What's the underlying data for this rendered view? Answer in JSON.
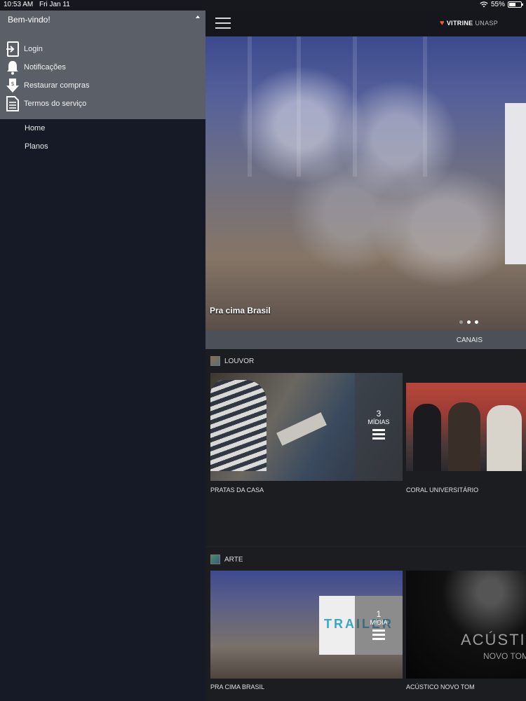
{
  "status_bar": {
    "time": "10:53 AM",
    "date": "Fri Jan 11",
    "battery": "55%",
    "battery_level": 0.55
  },
  "drawer": {
    "welcome": "Bem-vindo!",
    "menu": [
      {
        "label": "Login",
        "icon": "login-icon"
      },
      {
        "label": "Notificações",
        "icon": "bell-icon"
      },
      {
        "label": "Restaurar compras",
        "icon": "restore-purchase-icon"
      },
      {
        "label": "Termos do serviço",
        "icon": "document-icon"
      }
    ],
    "nav": [
      {
        "label": "Home"
      },
      {
        "label": "Planos"
      }
    ]
  },
  "header": {
    "brand_bold": "VITRINE",
    "brand_light": "UNASP"
  },
  "hero": {
    "caption": "Pra cima Brasil",
    "active_dot": 1,
    "dot_count": 3
  },
  "canais": "CANAIS",
  "sections": [
    {
      "title": "LOUVOR",
      "tiles": [
        {
          "title": "PRATAS DA CASA",
          "count": "3",
          "count_label": "MÍDIAS"
        },
        {
          "title": "CORAL UNIVERSITÁRIO"
        }
      ]
    },
    {
      "title": "ARTE",
      "tiles": [
        {
          "title": "PRA CIMA BRASIL",
          "count": "1",
          "count_label": "MÍDIA",
          "overlay_text": "TRAILER"
        },
        {
          "title": "ACÚSTICO NOVO TOM",
          "overlay_text": "ACÚSTIC",
          "overlay_sub": "NOVO TOM"
        }
      ]
    }
  ]
}
